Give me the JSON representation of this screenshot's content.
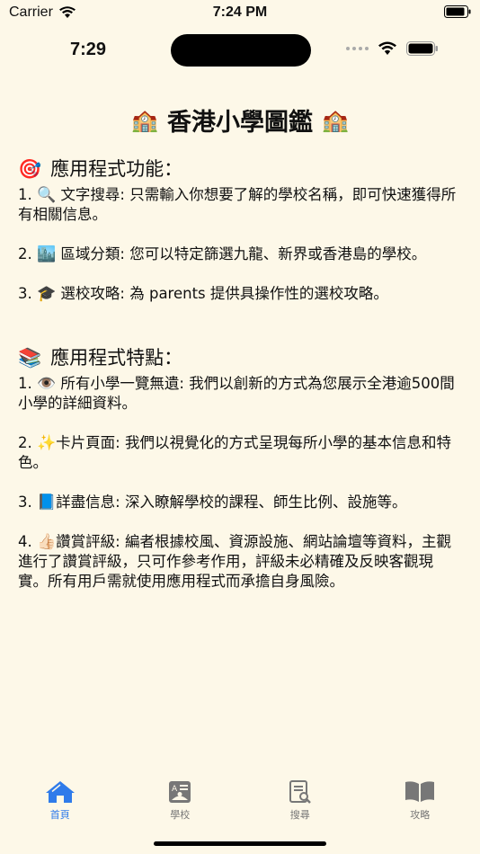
{
  "outer_status": {
    "carrier": "Carrier",
    "time": "7:24 PM"
  },
  "inner_status": {
    "time": "7:29"
  },
  "title": {
    "text": "香港小學圖鑑",
    "left_icon": "school-icon",
    "right_icon": "school-icon"
  },
  "section_features": {
    "icon": "target-icon",
    "heading": "應用程式功能：",
    "items": [
      {
        "num": "1.",
        "icon": "magnifier-icon",
        "text": "文字搜尋: 只需輸入你想要了解的學校名稱，即可快速獲得所有相關信息。"
      },
      {
        "num": "2.",
        "icon": "cityscape-icon",
        "text": "區域分類: 您可以特定篩選九龍、新界或香港島的學校。"
      },
      {
        "num": "3.",
        "icon": "graduation-cap-icon",
        "text": "選校攻略: 為 parents 提供具操作性的選校攻略。"
      }
    ]
  },
  "section_traits": {
    "icon": "books-icon",
    "heading": "應用程式特點：",
    "items": [
      {
        "num": "1.",
        "icon": "eye-icon",
        "text": "所有小學一覽無遺: 我們以創新的方式為您展示全港逾500間小學的詳細資料。"
      },
      {
        "num": "2.",
        "icon": "sparkles-icon",
        "text": "卡片頁面: 我們以視覺化的方式呈現每所小學的基本信息和特色。"
      },
      {
        "num": "3.",
        "icon": "blue-book-icon",
        "text": "詳盡信息: 深入瞭解學校的課程、師生比例、設施等。"
      },
      {
        "num": "4.",
        "icon": "thumbs-up-icon",
        "text": "讚賞評級: 編者根據校風、資源設施、網站論壇等資料，主觀進行了讚賞評級，只可作參考作用，評級未必精確及反映客觀現實。所有用戶需就使用應用程式而承擔自身風險。"
      }
    ]
  },
  "tabs": [
    {
      "label": "首頁",
      "icon": "house-icon",
      "active": true
    },
    {
      "label": "學校",
      "icon": "id-card-icon",
      "active": false
    },
    {
      "label": "搜尋",
      "icon": "document-search-icon",
      "active": false
    },
    {
      "label": "攻略",
      "icon": "open-book-icon",
      "active": false
    }
  ],
  "colors": {
    "background": "#fdf8e8",
    "accent": "#2f7bea",
    "inactive": "#777777"
  }
}
